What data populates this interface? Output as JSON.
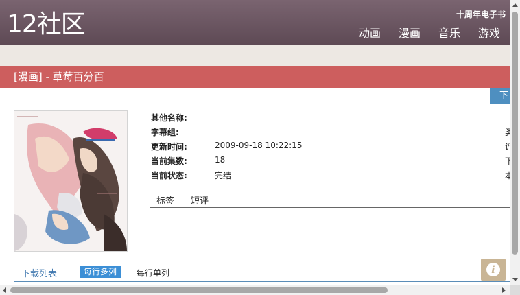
{
  "header": {
    "logo": "12社区",
    "ebook_link": "十周年电子书",
    "nav": [
      "动画",
      "漫画",
      "音乐",
      "游戏"
    ]
  },
  "title_bar": {
    "text": "[漫画] - 草莓百分百"
  },
  "download_tab_partial": "下",
  "info": {
    "rows": [
      {
        "label": "其他名称:",
        "value": ""
      },
      {
        "label": "字幕组:",
        "value": ""
      },
      {
        "label": "更新时间:",
        "value": "2009-09-18 10:22:15"
      },
      {
        "label": "当前集数:",
        "value": "18"
      },
      {
        "label": "当前状态:",
        "value": "完结"
      }
    ],
    "right_edge_chars": [
      "类",
      "评",
      "下",
      "本"
    ]
  },
  "sub_tabs": [
    "标签",
    "短评"
  ],
  "download": {
    "title": "下载列表",
    "multi": "每行多列",
    "single": "每行单列"
  },
  "colors": {
    "header": "#6b5661",
    "title_bar": "#cd5e5e",
    "accent_blue": "#3c8fd6"
  }
}
